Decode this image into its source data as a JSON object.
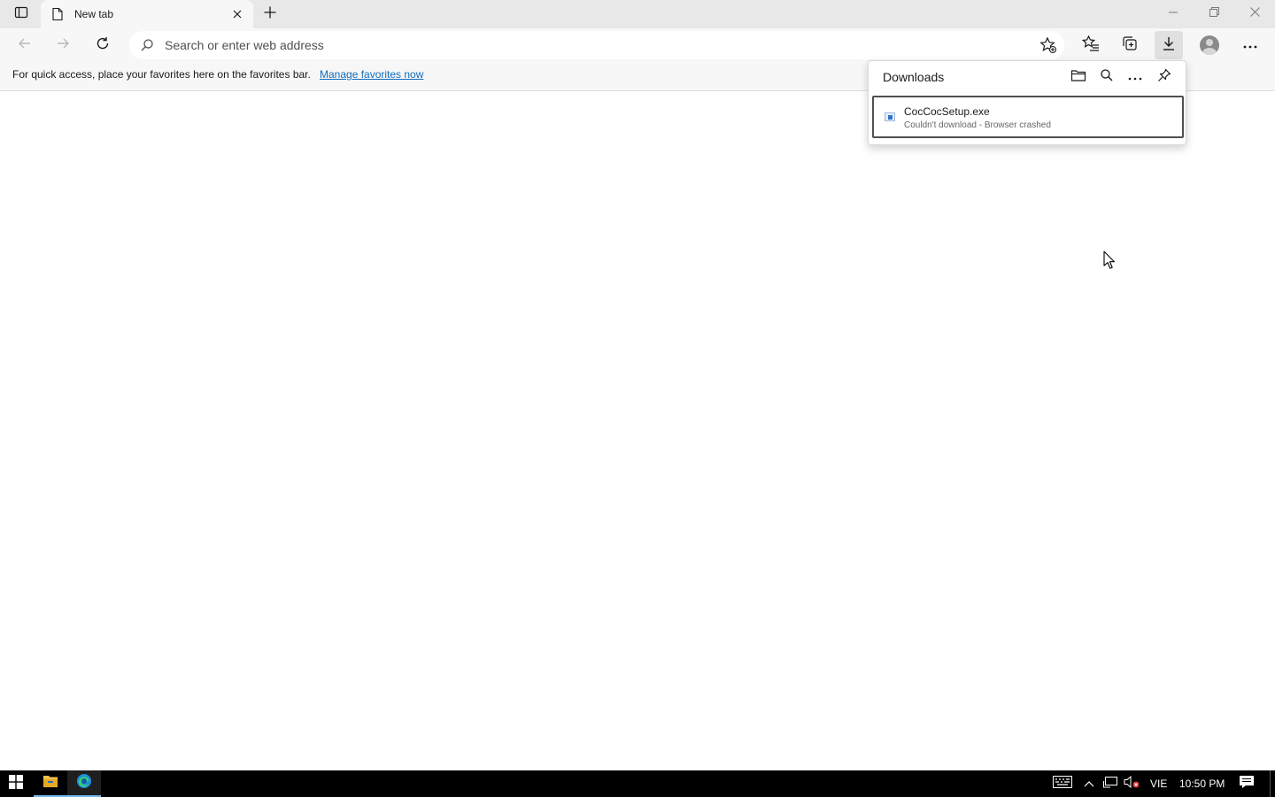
{
  "browser": {
    "tab": {
      "title": "New tab"
    },
    "addressbar": {
      "placeholder": "Search or enter web address"
    },
    "favorites_bar": {
      "message": "For quick access, place your favorites here on the favorites bar.",
      "link_text": "Manage favorites now"
    },
    "downloads": {
      "title": "Downloads",
      "items": [
        {
          "filename": "CocCocSetup.exe",
          "status": "Couldn't download - Browser crashed"
        }
      ]
    }
  },
  "taskbar": {
    "language": "VIE",
    "time": "10:50 PM"
  },
  "colors": {
    "accent_link": "#0f6cbd",
    "taskbar": "#000000",
    "chrome_bg": "#f7f7f7"
  }
}
